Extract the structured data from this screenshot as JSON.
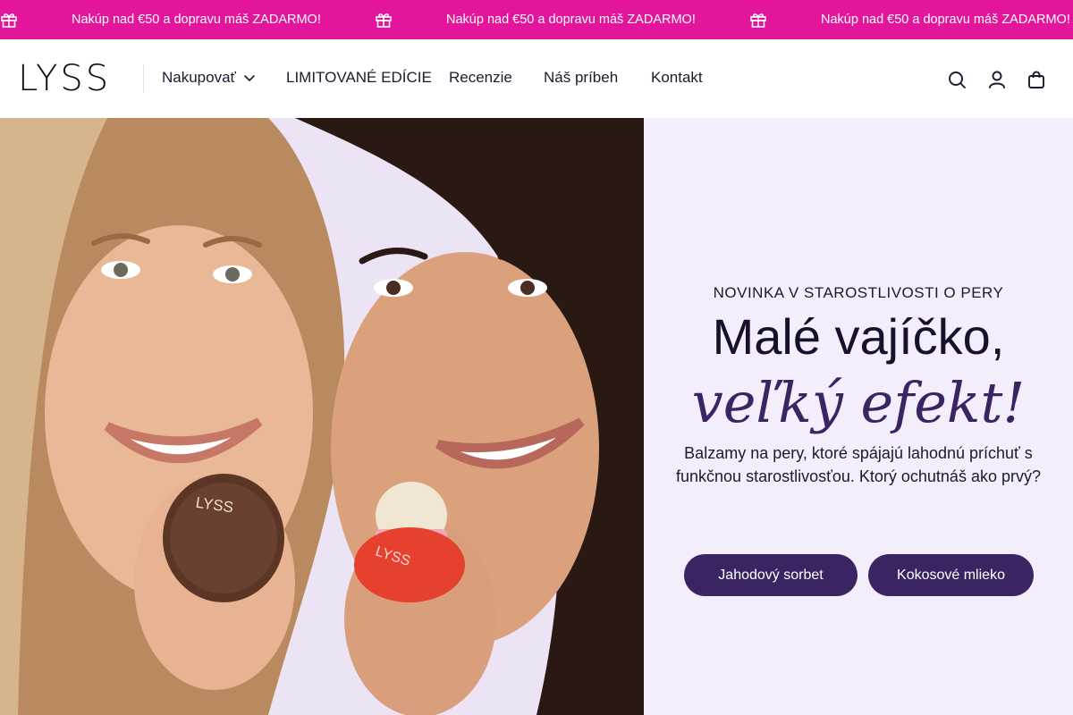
{
  "announcement": {
    "messages": [
      "Nakúp nad €50 a dopravu máš ZADARMO!",
      "Nakúp nad €50 a dopravu máš ZADARMO!",
      "Nakúp nad €50 a dopravu máš ZADARMO!"
    ],
    "icon": "gift-icon",
    "background": "#e2159b"
  },
  "header": {
    "logo": "LYSS",
    "nav": [
      {
        "label": "Nakupovať",
        "has_dropdown": true
      },
      {
        "label": "LIMITOVANÉ EDÍCIE"
      },
      {
        "label": "Recenzie"
      },
      {
        "label": "Náš príbeh"
      },
      {
        "label": "Kontakt"
      }
    ],
    "icons": [
      "search-icon",
      "account-icon",
      "cart-icon"
    ]
  },
  "hero": {
    "eyebrow": "NOVINKA V STAROSTLIVOSTI O PERY",
    "headline": "Malé vajíčko,",
    "headline_italic": "veľký efekt!",
    "description": "Balzamy na pery, ktoré spájajú lahodnú príchuť s funkčnou starostlivosťou. Ktorý ochutnáš ako prvý?",
    "buttons": [
      {
        "label": "Jahodový sorbet"
      },
      {
        "label": "Kokosové mlieko"
      }
    ],
    "product_labels": [
      "LYSS",
      "LYSS"
    ],
    "colors": {
      "panel": "#f4edfc",
      "button": "#3a2462",
      "italic": "#3a2462"
    }
  }
}
